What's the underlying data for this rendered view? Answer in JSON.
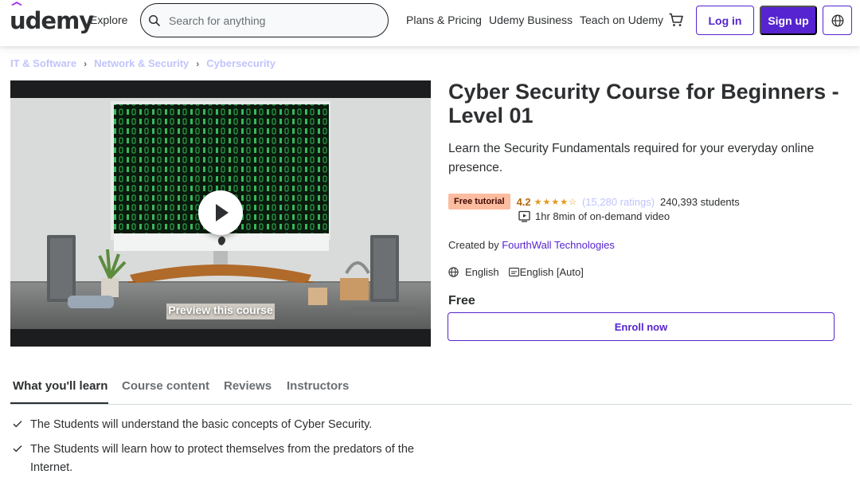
{
  "header": {
    "logo": "udemy",
    "explore": "Explore",
    "search_placeholder": "Search for anything",
    "plans": "Plans & Pricing",
    "business": "Udemy Business",
    "teach": "Teach on Udemy",
    "login": "Log in",
    "signup": "Sign up"
  },
  "breadcrumb": [
    "IT & Software",
    "Network & Security",
    "Cybersecurity"
  ],
  "preview": {
    "caption": "Preview this course"
  },
  "course": {
    "title": "Cyber Security Course for Beginners - Level 01",
    "subtitle": "Learn the Security Fundamentals required for your everyday online presence.",
    "badge": "Free tutorial",
    "rating": "4.2",
    "stars_value": 4.2,
    "ratings_count": "(15,280 ratings)",
    "students": "240,393 students",
    "video": "1hr 8min of on-demand video",
    "created_prefix": "Created by ",
    "author": "FourthWall Technologies",
    "language": "English",
    "captions": "English [Auto]",
    "price": "Free",
    "enroll": "Enroll now"
  },
  "tabs": [
    "What you'll learn",
    "Course content",
    "Reviews",
    "Instructors"
  ],
  "learn": [
    "The Students will understand the basic concepts of Cyber Security.",
    "The Students will learn how to protect themselves from the predators of the Internet."
  ],
  "colors": {
    "brand": "#5624d0",
    "badge_bg": "#fcbca0",
    "star": "#e59819",
    "rating": "#b4690e",
    "link_light": "#c0c4fc"
  }
}
